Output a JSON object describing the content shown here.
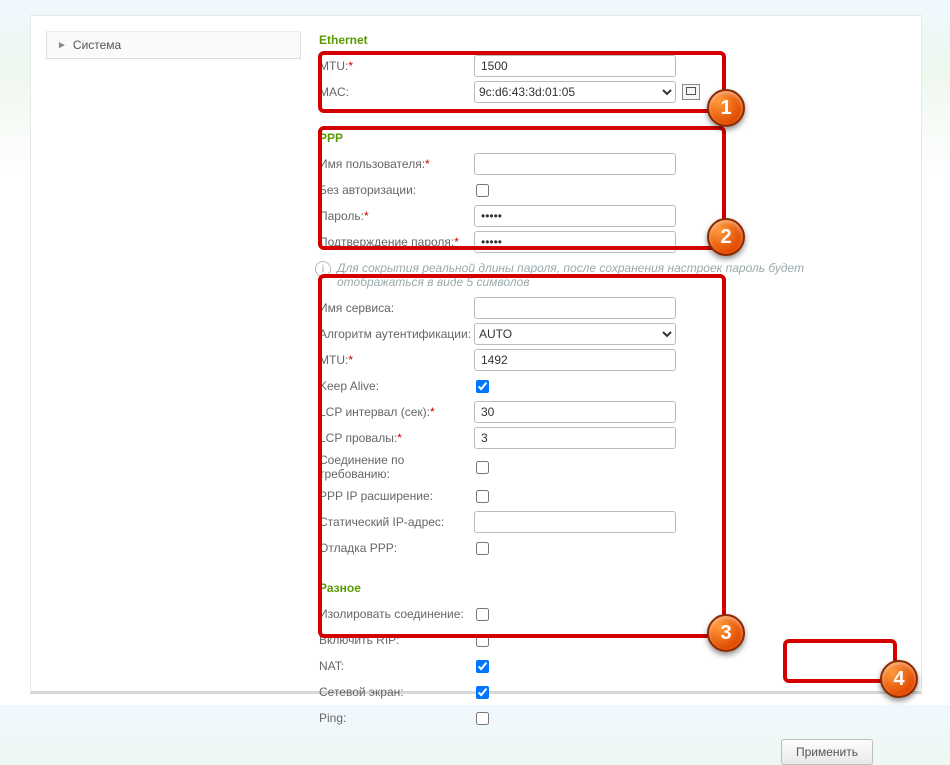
{
  "sidebar": {
    "item_label": "Система"
  },
  "ethernet": {
    "title": "Ethernet",
    "mtu_label": "MTU:",
    "mtu_value": "1500",
    "mac_label": "MAC:",
    "mac_value": "9c:d6:43:3d:01:05"
  },
  "ppp": {
    "title": "PPP",
    "user_label": "Имя пользователя:",
    "user_value": "",
    "noauth_label": "Без авторизации:",
    "noauth_checked": false,
    "pass_label": "Пароль:",
    "pass_value": "•••••",
    "pass2_label": "Подтверждение пароля:",
    "pass2_value": "•••••",
    "note_text": "Для сокрытия реальной длины пароля, после сохранения настроек пароль будет отображаться в виде 5 символов",
    "service_label": "Имя сервиса:",
    "service_value": "",
    "auth_label": "Алгоритм аутентификации:",
    "auth_value": "AUTO",
    "mtu_label": "MTU:",
    "mtu_value": "1492",
    "keepalive_label": "Keep Alive:",
    "keepalive_checked": true,
    "lcp_int_label": "LCP интервал (сек):",
    "lcp_int_value": "30",
    "lcp_fail_label": "LCP провалы:",
    "lcp_fail_value": "3",
    "ondemand_label": "Соединение по требованию:",
    "ondemand_checked": false,
    "ipext_label": "PPP IP расширение:",
    "ipext_checked": false,
    "static_ip_label": "Статический IP-адрес:",
    "static_ip_value": "",
    "debug_label": "Отладка PPP:",
    "debug_checked": false
  },
  "misc": {
    "title": "Разное",
    "isolate_label": "Изолировать соединение:",
    "isolate_checked": false,
    "rip_label": "Включить RIP:",
    "rip_checked": false,
    "nat_label": "NAT:",
    "nat_checked": true,
    "fw_label": "Сетевой экран:",
    "fw_checked": true,
    "ping_label": "Ping:",
    "ping_checked": false
  },
  "apply_label": "Применить",
  "badges": {
    "b1": "1",
    "b2": "2",
    "b3": "3",
    "b4": "4"
  }
}
